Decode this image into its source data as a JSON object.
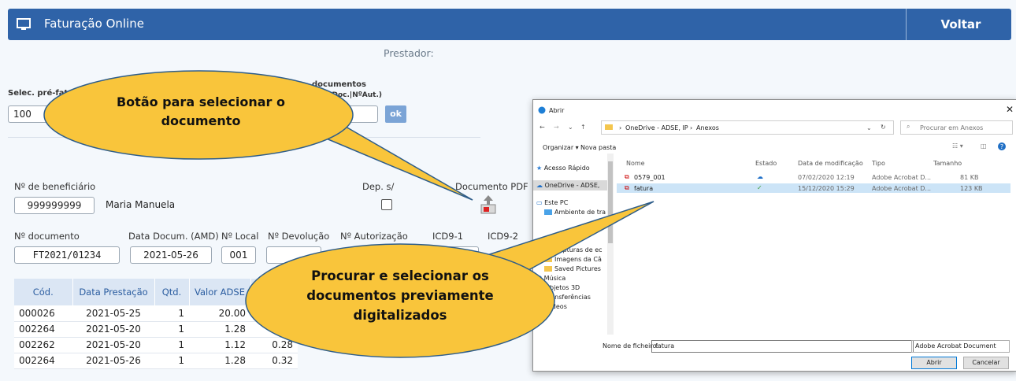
{
  "header": {
    "title": "Faturação Online",
    "back_label": "Voltar",
    "icon": "monitor-icon"
  },
  "labels": {
    "prestador": "Prestador:",
    "selec_pre": "Selec. pré-fat",
    "documentos": "documentos",
    "data_doc_aut": "ta Doc.|NºAut.)",
    "ok": "ok",
    "n_beneficiario": "Nº de beneficiário",
    "dep": "Dep. s/",
    "documento_pdf": "Documento PDF",
    "n_documento": "Nº documento",
    "data_docum": "Data Docum. (AMD)",
    "n_local": "Nº Local",
    "n_devolucao": "Nº Devolução",
    "n_autorizacao": "Nº Autorização",
    "icd9_1": "ICD9-1",
    "icd9_2": "ICD9-2"
  },
  "fields": {
    "pre_fat": "100",
    "beneficiario": "999999999",
    "beneficiario_nome": "Maria Manuela",
    "documento": "FT2021/01234",
    "data_docum": "2021-05-26",
    "local": "001"
  },
  "table": {
    "headers": [
      "Cód.",
      "Data Prestação",
      "Qtd.",
      "Valor ADSE"
    ],
    "rows": [
      [
        "000026",
        "2021-05-25",
        "1",
        "20.00",
        ""
      ],
      [
        "002264",
        "2021-05-20",
        "1",
        "1.28",
        ""
      ],
      [
        "002262",
        "2021-05-20",
        "1",
        "1.12",
        "0.28"
      ],
      [
        "002264",
        "2021-05-26",
        "1",
        "1.28",
        "0.32"
      ]
    ]
  },
  "callouts": {
    "top": "Botão para selecionar o documento",
    "bottom": "Procurar e selecionar os documentos previamente digitalizados"
  },
  "dialog": {
    "title": "Abrir",
    "path": [
      "OneDrive - ADSE, IP",
      "Anexos"
    ],
    "search_placeholder": "Procurar em Anexos",
    "organize": "Organizar ▾",
    "new_folder": "Nova pasta",
    "nav_items": [
      "Acesso Rápido",
      "OneDrive - ADSE,",
      "Este PC",
      "Ambiente de tra",
      "Capturas de ec",
      "Imagens da Câ",
      "Saved Pictures",
      "Música",
      "Objetos 3D",
      "Transferências",
      "Vídeos"
    ],
    "columns": [
      "Nome",
      "Estado",
      "Data de modificação",
      "Tipo",
      "Tamanho"
    ],
    "files": [
      {
        "name": "0579_001",
        "date": "07/02/2020 12:19",
        "type": "Adobe Acrobat D...",
        "size": "81 KB"
      },
      {
        "name": "fatura",
        "date": "15/12/2020 15:29",
        "type": "Adobe Acrobat D...",
        "size": "123 KB"
      }
    ],
    "filename_label": "Nome de ficheiro:",
    "filename_value": "fatura",
    "filetype": "Adobe Acrobat Document",
    "open_label": "Abrir",
    "cancel_label": "Cancelar"
  }
}
